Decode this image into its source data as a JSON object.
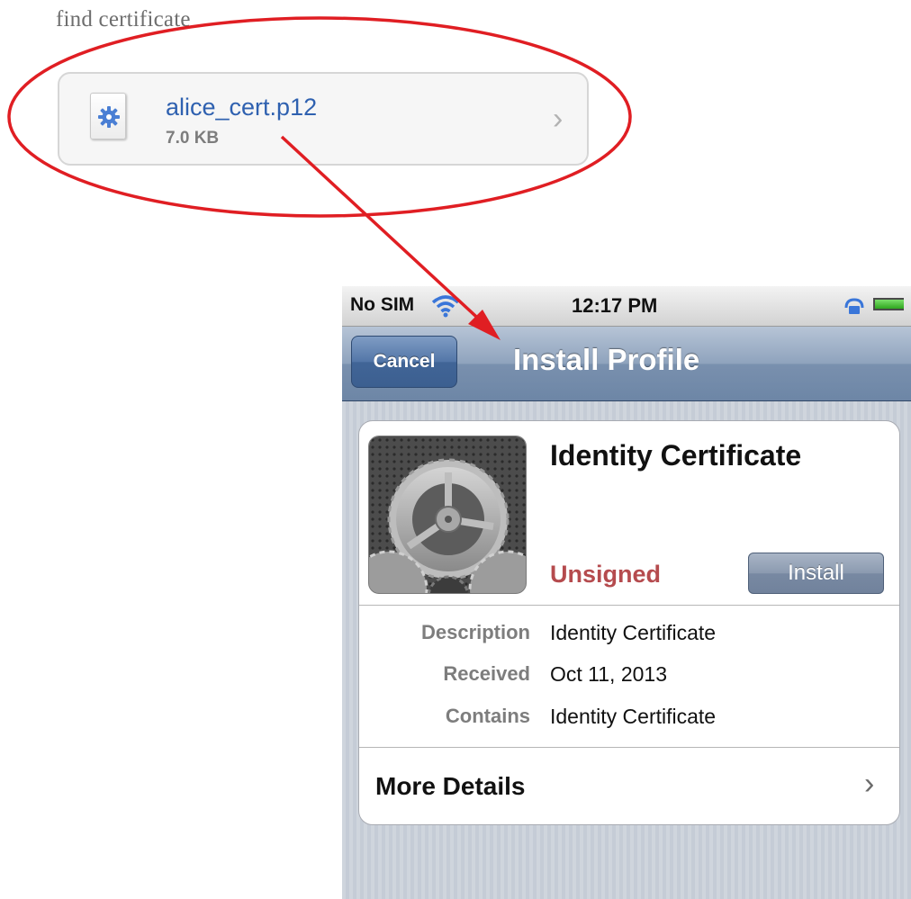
{
  "caption": "find certificate",
  "attachment": {
    "name": "alice_cert.p12",
    "size": "7.0 KB",
    "icon": "gear-file-icon"
  },
  "phone": {
    "status_bar": {
      "carrier": "No SIM",
      "time": "12:17 PM"
    },
    "nav_bar": {
      "cancel_label": "Cancel",
      "title": "Install Profile"
    },
    "profile": {
      "title": "Identity Certificate",
      "status": "Unsigned",
      "install_label": "Install",
      "details": [
        {
          "label": "Description",
          "value": "Identity Certificate"
        },
        {
          "label": "Received",
          "value": "Oct 11, 2013"
        },
        {
          "label": "Contains",
          "value": "Identity Certificate"
        }
      ],
      "more_details_label": "More Details"
    }
  },
  "colors": {
    "annotation": "#e01e23",
    "link_blue": "#2f61b0",
    "unsigned_red": "#b54b4e",
    "nav_blue": "#6d86a6"
  }
}
